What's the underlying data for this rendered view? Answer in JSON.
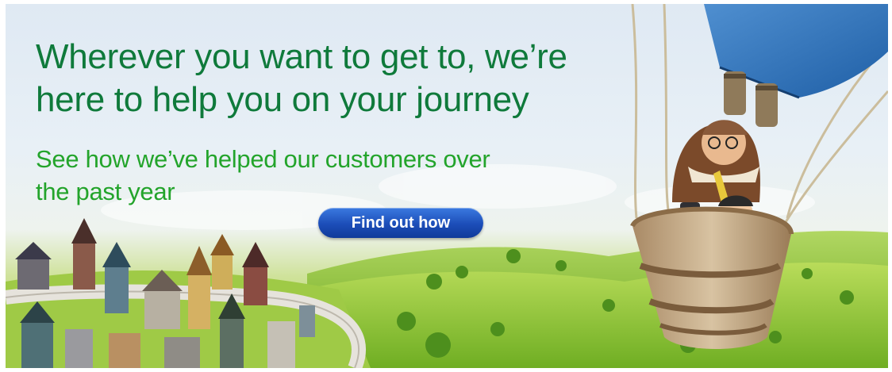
{
  "banner": {
    "headline": "Wherever you want to get to, we’re here to help you on your journey",
    "subhead": "See how we’ve helped our customers over the past year",
    "cta_label": "Find out how"
  },
  "colors": {
    "headline": "#0f7a3b",
    "subhead": "#23a42b",
    "button": "#1c4db8",
    "hills": "#8fc43a"
  },
  "illustration": {
    "balloon": "hot-air-balloon",
    "town": "village-illustration"
  }
}
